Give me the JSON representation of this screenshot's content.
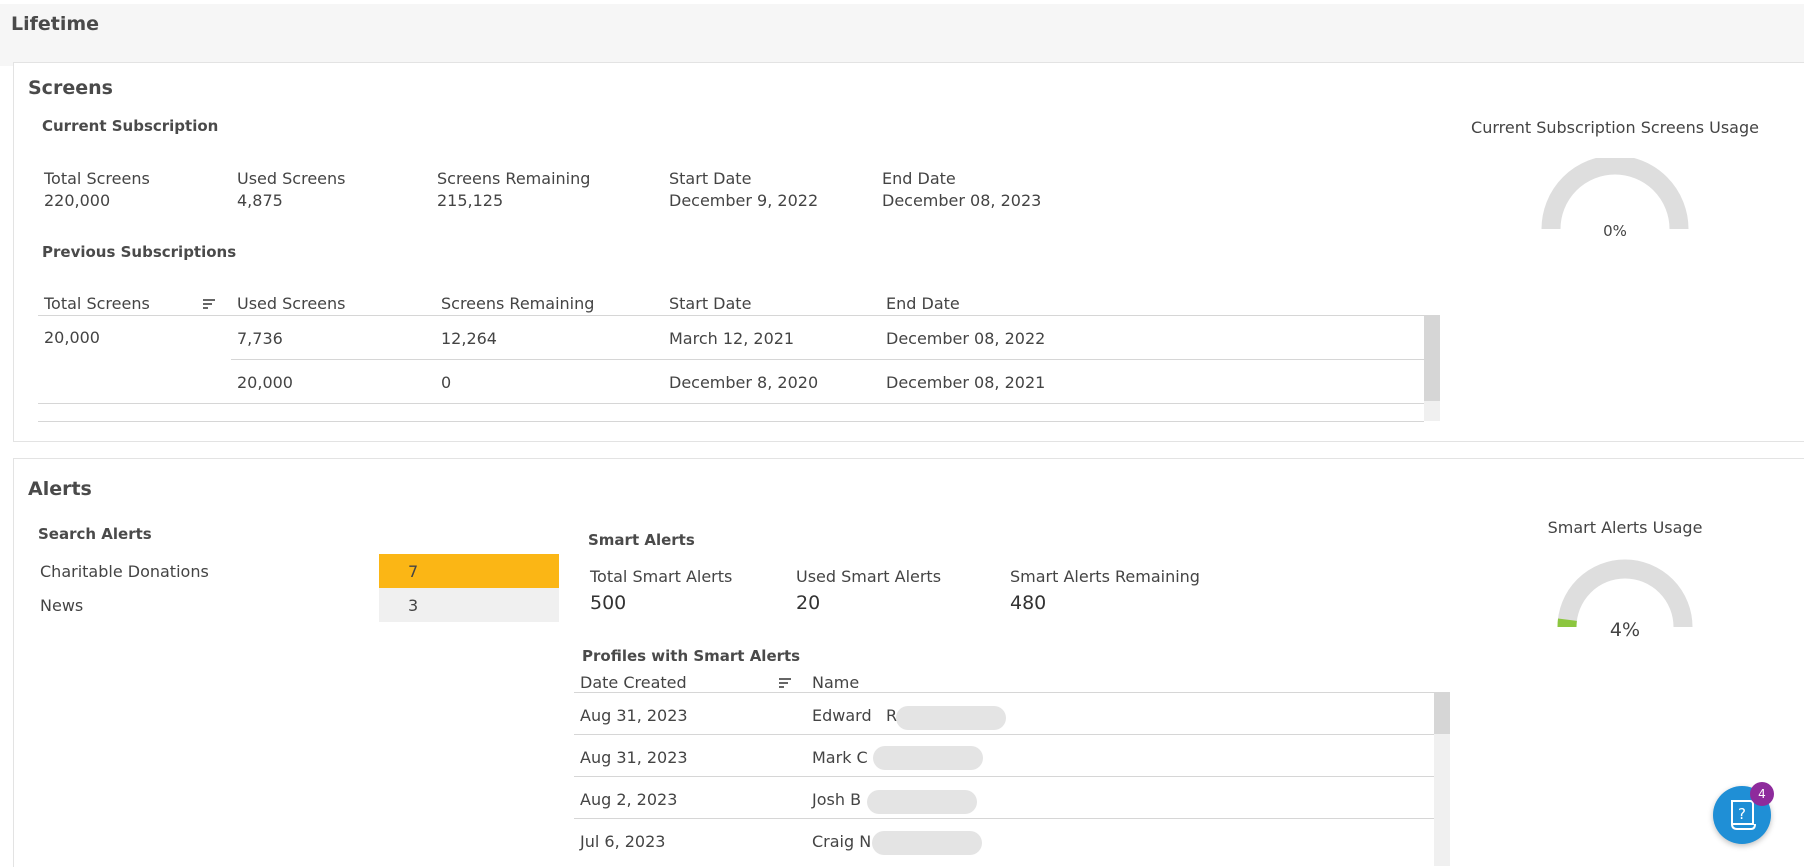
{
  "page": {
    "title": "Lifetime"
  },
  "screens": {
    "title": "Screens",
    "current": {
      "title": "Current Subscription",
      "total_label": "Total Screens",
      "total": "220,000",
      "used_label": "Used Screens",
      "used": "4,875",
      "remaining_label": "Screens Remaining",
      "remaining": "215,125",
      "start_label": "Start Date",
      "start": "December 9, 2022",
      "end_label": "End Date",
      "end": "December 08, 2023"
    },
    "previous": {
      "title": "Previous Subscriptions",
      "headers": [
        "Total Screens",
        "Used Screens",
        "Screens Remaining",
        "Start Date",
        "End Date"
      ],
      "rows": [
        {
          "total": "20,000",
          "used": "7,736",
          "remaining": "12,264",
          "start": "March 12, 2021",
          "end": "December 08, 2022"
        },
        {
          "total": "",
          "used": "20,000",
          "remaining": "0",
          "start": "December 8, 2020",
          "end": "December 08, 2021"
        }
      ]
    },
    "gauge": {
      "title": "Current Subscription Screens Usage",
      "value_label": "0%",
      "value": 0
    }
  },
  "alerts": {
    "title": "Alerts",
    "search": {
      "title": "Search Alerts",
      "items": [
        {
          "label": "Charitable Donations",
          "count": "7",
          "color": "#fbb615"
        },
        {
          "label": "News",
          "count": "3",
          "color": "#f0f0f0"
        }
      ]
    },
    "smart": {
      "title": "Smart Alerts",
      "total_label": "Total Smart Alerts",
      "total": "500",
      "used_label": "Used Smart Alerts",
      "used": "20",
      "remaining_label": "Smart Alerts Remaining",
      "remaining": "480"
    },
    "profiles": {
      "title": "Profiles with Smart Alerts",
      "headers": [
        "Date Created",
        "Name"
      ],
      "rows": [
        {
          "date": "Aug 31, 2023",
          "name": "Edward",
          "initial": "R"
        },
        {
          "date": "Aug 31, 2023",
          "name": "Mark C",
          "initial": ""
        },
        {
          "date": "Aug 2, 2023",
          "name": "Josh B",
          "initial": ""
        },
        {
          "date": "Jul 6, 2023",
          "name": "Craig N",
          "initial": ""
        }
      ]
    },
    "gauge": {
      "title": "Smart Alerts Usage",
      "value_label": "4%",
      "value": 0.04
    }
  },
  "help": {
    "badge": "4",
    "icon": "help-document-icon"
  },
  "colors": {
    "accent": "#1f8fd6",
    "orange": "#fbb615",
    "gauge_fill": "#8cc63f",
    "badge": "#8e2b9c"
  }
}
